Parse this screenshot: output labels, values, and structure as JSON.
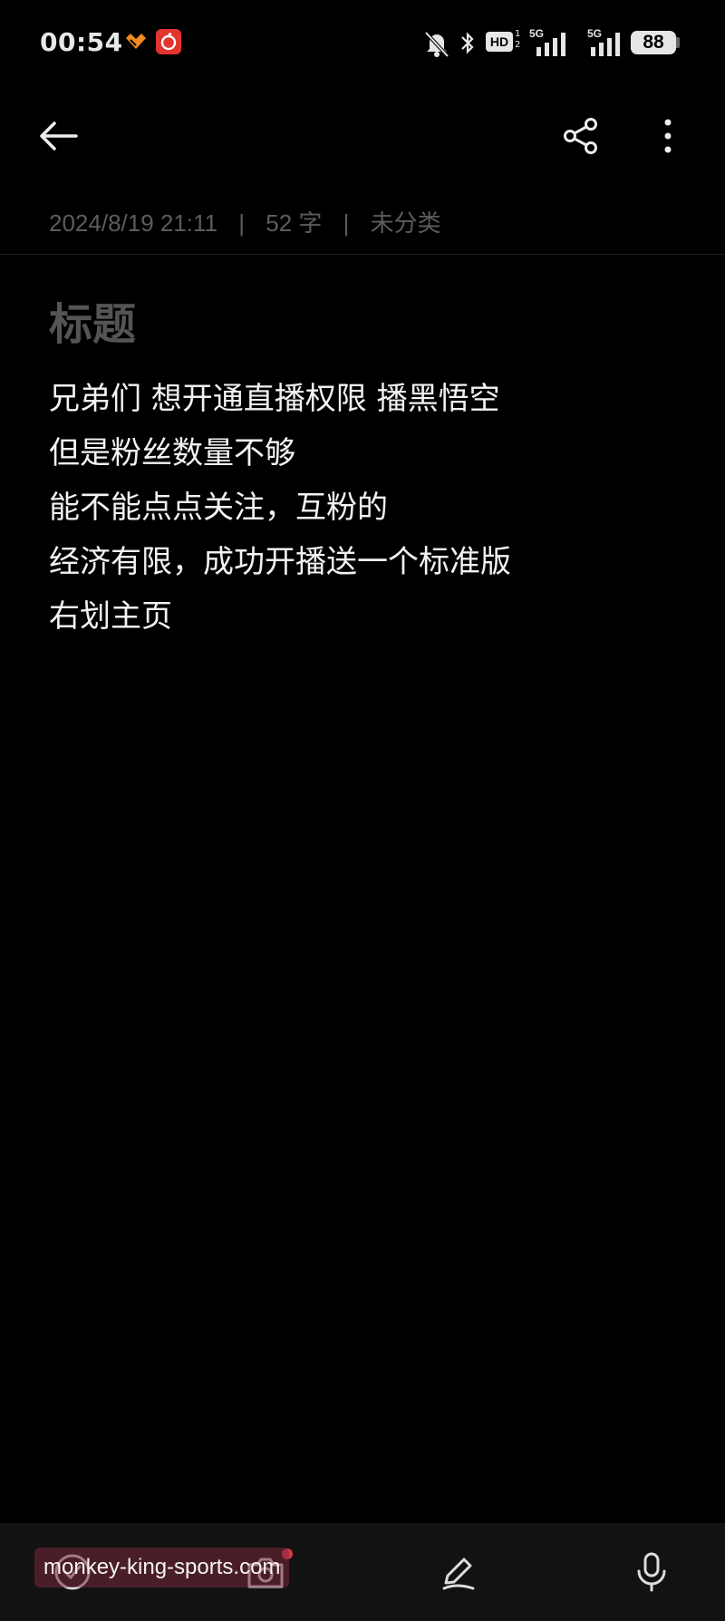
{
  "status_bar": {
    "time": "00:54",
    "network_left": "5G",
    "network_right": "5G",
    "hd_label": "HD",
    "battery": "88"
  },
  "toolbar": {
    "back_icon": "arrow-left-icon",
    "share_icon": "share-icon",
    "more_icon": "more-vertical-icon"
  },
  "meta": {
    "datetime": "2024/8/19 21:11",
    "word_count": "52 字",
    "category": "未分类",
    "separator": "|"
  },
  "note": {
    "title": "标题",
    "lines": [
      "兄弟们 想开通直播权限 播黑悟空",
      "但是粉丝数量不够",
      "能不能点点关注，互粉的",
      "经济有限，成功开播送一个标准版",
      "右划主页"
    ]
  },
  "bottom_bar": {
    "items": [
      "checklist-icon",
      "camera-icon",
      "pen-icon",
      "microphone-icon"
    ]
  },
  "watermark": "monkey-king-sports.com",
  "colors": {
    "background": "#000000",
    "text": "#f2f2f2",
    "meta_text": "#5c5c5c",
    "title_text": "#545454",
    "bottom_bar": "#121212",
    "accent_red": "#e3342f"
  }
}
